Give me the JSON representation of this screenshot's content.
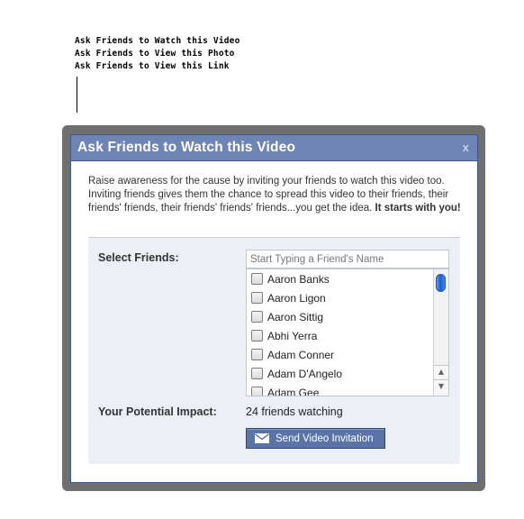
{
  "top_links": [
    "Ask Friends to Watch this Video",
    "Ask Friends to View this Photo",
    "Ask Friends to View this Link"
  ],
  "dialog": {
    "title": "Ask Friends to Watch this Video",
    "close_label": "x",
    "intro_text": "Raise awareness for the cause by inviting your friends to watch this video too. Inviting friends gives them the chance to spread this video to their friends, their friends' friends, their friends' friends' friends...you get the idea.",
    "intro_bold": "It starts with you!",
    "select_friends_label": "Select Friends:",
    "search": {
      "placeholder": "Start Typing a Friend's Name",
      "value": ""
    },
    "friends": [
      {
        "name": "Aaron Banks",
        "checked": false
      },
      {
        "name": "Aaron Ligon",
        "checked": false
      },
      {
        "name": "Aaron Sittig",
        "checked": false
      },
      {
        "name": "Abhi Yerra",
        "checked": false
      },
      {
        "name": "Adam Conner",
        "checked": false
      },
      {
        "name": "Adam D'Angelo",
        "checked": false
      },
      {
        "name": "Adam Gee",
        "checked": false
      }
    ],
    "impact_label": "Your Potential Impact:",
    "impact_value": "24 friends watching",
    "send_button_label": "Send Video Invitation",
    "send_button_icon": "envelope-icon"
  },
  "colors": {
    "header_bg": "#6d84b4",
    "header_border": "#3b5998",
    "panel_bg": "#eceff5",
    "button_bg": "#5b74a8",
    "frame": "#6f6f6f"
  }
}
